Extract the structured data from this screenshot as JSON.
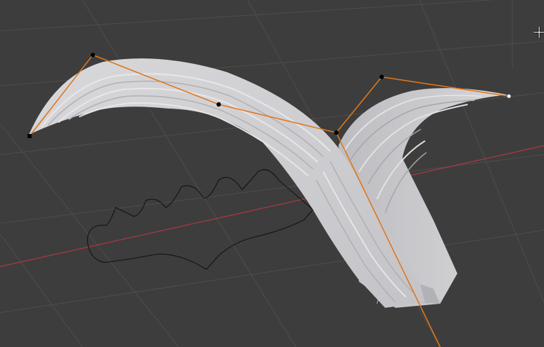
{
  "viewport": {
    "name": "3D Viewport",
    "background_color": "#3d3d3d",
    "grid_color": "#4e4e4e",
    "x_axis_color": "#9b3a44"
  },
  "objects": {
    "mesh_color": "#cfcfd2",
    "mesh_shadow_color": "#a9a9ad",
    "control_polygon_color": "#e0761a",
    "control_point_color": "#000000",
    "active_point_color": "#ffffff",
    "outline_curve_color": "#111111"
  },
  "icons": {
    "cursor": "crosshair-cursor-icon"
  }
}
